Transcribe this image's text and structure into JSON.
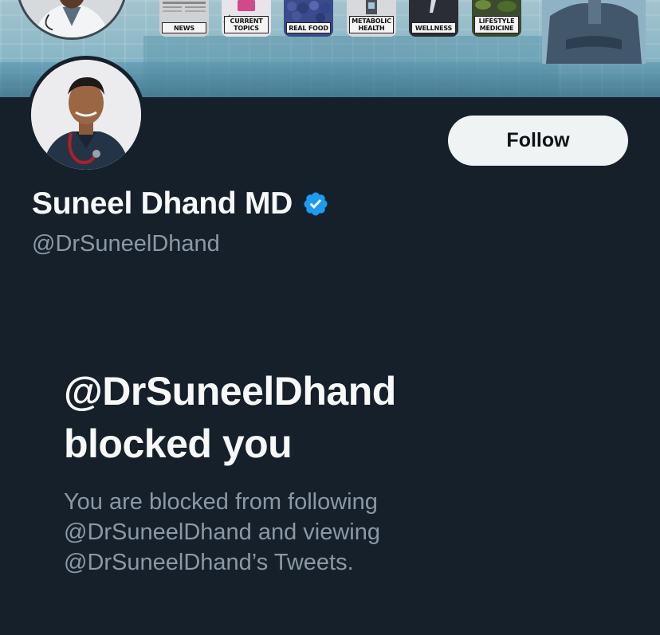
{
  "banner": {
    "tiles": [
      {
        "label": "NEWS"
      },
      {
        "label": "CURRENT\nTOPICS"
      },
      {
        "label": "REAL FOOD"
      },
      {
        "label": "METABOLIC\nHEALTH"
      },
      {
        "label": "WELLNESS"
      },
      {
        "label": "LIFESTYLE\nMEDICINE"
      }
    ]
  },
  "profile": {
    "display_name": "Suneel Dhand MD",
    "handle": "@DrSuneelDhand",
    "verified": true,
    "follow_label": "Follow"
  },
  "blocked": {
    "title_line1": "@DrSuneelDhand",
    "title_line2": "blocked you",
    "desc_line1": "You are blocked from following",
    "desc_line2": "@DrSuneelDhand and viewing",
    "desc_line3": "@DrSuneelDhand’s Tweets."
  },
  "colors": {
    "background": "#15202b",
    "primary_text": "#f7f9f9",
    "secondary_text": "#8b98a5",
    "follow_button_bg": "#eff3f4",
    "verified_badge": "#1d9bf0"
  }
}
